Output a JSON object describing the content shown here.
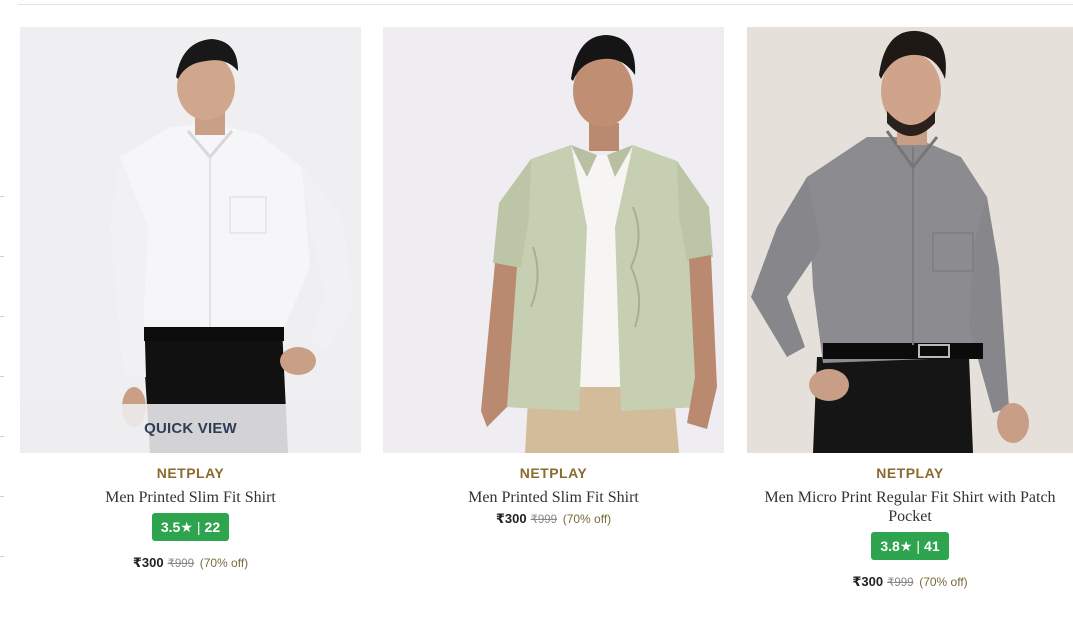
{
  "products": [
    {
      "brand": "NETPLAY",
      "name": "Men Printed Slim Fit Shirt",
      "rating": "3.5",
      "star": "★",
      "sep": "|",
      "reviews": "22",
      "price": "₹300",
      "mrp": "₹999",
      "discount": "(70% off)",
      "quick_view": "QUICK VIEW"
    },
    {
      "brand": "NETPLAY",
      "name": "Men Printed Slim Fit Shirt",
      "price": "₹300",
      "mrp": "₹999",
      "discount": "(70% off)"
    },
    {
      "brand": "NETPLAY",
      "name": "Men Micro Print Regular Fit Shirt with Patch Pocket",
      "rating": "3.8",
      "star": "★",
      "sep": "|",
      "reviews": "41",
      "price": "₹300",
      "mrp": "₹999",
      "discount": "(70% off)"
    }
  ],
  "colors": {
    "brand": "#8b6b2f",
    "rating_bg": "#2ea44f",
    "quickview_text": "#2f3d55"
  }
}
